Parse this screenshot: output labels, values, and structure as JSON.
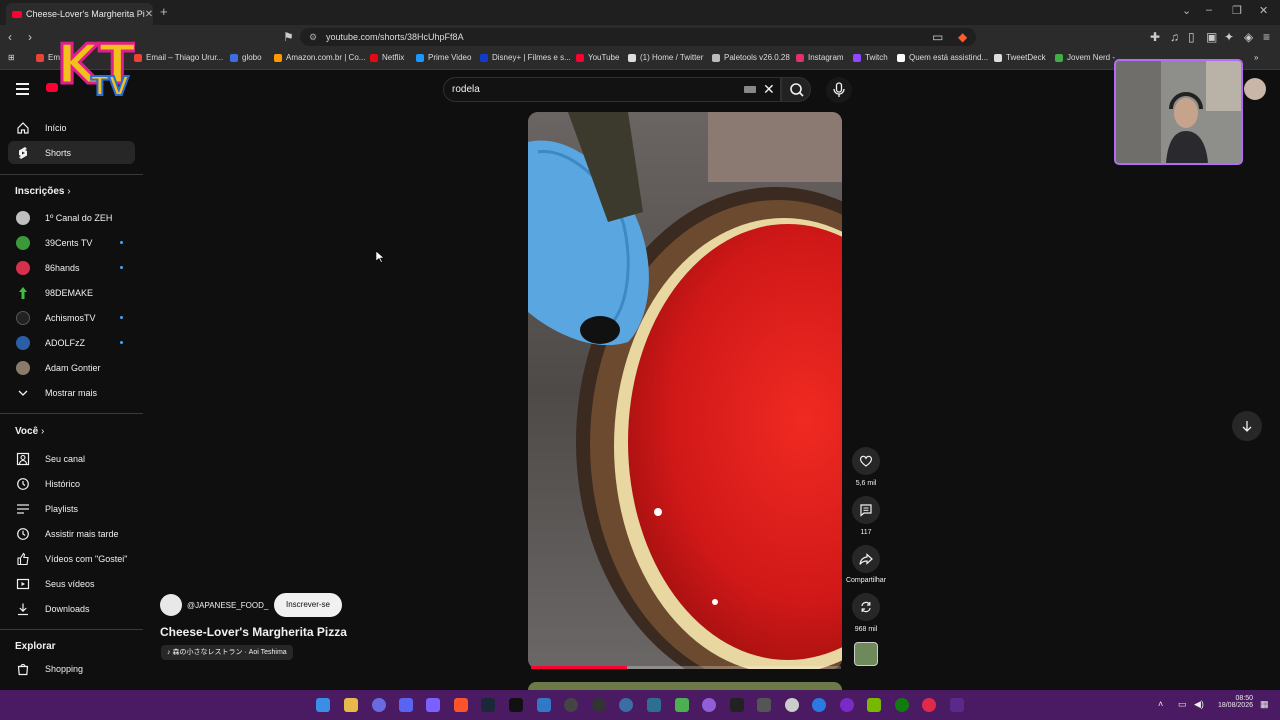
{
  "browser": {
    "tab_title": "Cheese-Lover's Margherita Pi",
    "tab_close": "✕",
    "new_tab": "+",
    "url": "youtube.com/shorts/38HcUhpFf8A",
    "bookmarks": [
      {
        "label": "Email – Thiago Urur...",
        "color": "#ea4335"
      },
      {
        "label": "globo",
        "color": "#3b6fe0"
      },
      {
        "label": "Amazon.com.br | Co...",
        "color": "#ff9900"
      },
      {
        "label": "Netflix",
        "color": "#e50914"
      },
      {
        "label": "Prime Video",
        "color": "#1a98ff"
      },
      {
        "label": "Disney+ | Filmes e s...",
        "color": "#113ccf"
      },
      {
        "label": "YouTube",
        "color": "#ff0033"
      },
      {
        "label": "(1) Home / Twitter",
        "color": "#dddddd"
      },
      {
        "label": "Paletools v26.0.28",
        "color": "#bbbbbb"
      },
      {
        "label": "Instagram",
        "color": "#e1306c"
      },
      {
        "label": "Twitch",
        "color": "#9146ff"
      },
      {
        "label": "Quem está assistind...",
        "color": "#ffffff"
      },
      {
        "label": "TweetDeck",
        "color": "#dddddd"
      },
      {
        "label": "Jovem Nerd -",
        "color": "#3fae49"
      }
    ],
    "bookmark_first_partial": "Em"
  },
  "header": {
    "logo_text": "KTV",
    "search_value": "rodela"
  },
  "sidebar": {
    "main": [
      {
        "label": "Início",
        "icon": "home-icon"
      },
      {
        "label": "Shorts",
        "icon": "shorts-icon",
        "active": true
      }
    ],
    "subscriptions_title": "Inscrições",
    "subscriptions": [
      {
        "label": "1º Canal do ZEH",
        "color": "#bfbfbf",
        "dot": false
      },
      {
        "label": "39Cents TV",
        "color": "#3a9a3a",
        "dot": true
      },
      {
        "label": "86hands",
        "color": "#d6304a",
        "dot": true
      },
      {
        "label": "98DEMAKE",
        "color": "#3fbf3f",
        "dot": false
      },
      {
        "label": "AchismosTV",
        "color": "#222222",
        "dot": true
      },
      {
        "label": "ADOLFzZ",
        "color": "#2a5fa8",
        "dot": true
      },
      {
        "label": "Adam Gontier",
        "color": "#8a7a6a",
        "dot": false
      }
    ],
    "show_more": "Mostrar mais",
    "you_title": "Você",
    "you": [
      {
        "label": "Seu canal",
        "icon": "channel-icon"
      },
      {
        "label": "Histórico",
        "icon": "history-icon"
      },
      {
        "label": "Playlists",
        "icon": "playlist-icon"
      },
      {
        "label": "Assistir mais tarde",
        "icon": "watch-later-icon"
      },
      {
        "label": "Vídeos com \"Gostei\"",
        "icon": "like-icon"
      },
      {
        "label": "Seus vídeos",
        "icon": "your-videos-icon"
      },
      {
        "label": "Downloads",
        "icon": "download-icon"
      }
    ],
    "explore_title": "Explorar",
    "explore": [
      {
        "label": "Shopping",
        "icon": "shopping-icon"
      }
    ]
  },
  "short": {
    "channel": "@JAPANESE_FOOD_",
    "subscribe_label": "Inscrever-se",
    "title": "Cheese-Lover's Margherita Pizza",
    "music": "森の小さなレストラン · Aoi Teshima",
    "progress": 0.31,
    "actions": {
      "likes": "5,6 mil",
      "comments": "117",
      "share": "Compartilhar",
      "remix": "968 mil"
    }
  },
  "taskbar": {
    "time": "08:50",
    "date": "18/08/2026",
    "color": "#4a1a62"
  }
}
